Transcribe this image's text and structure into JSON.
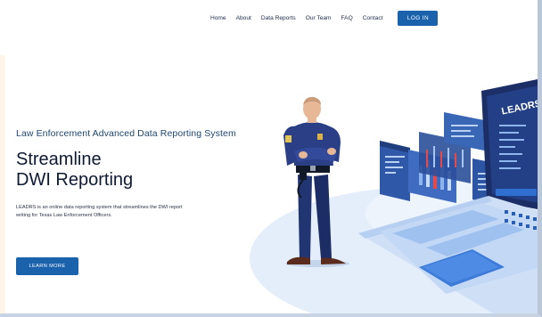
{
  "nav": {
    "items": [
      {
        "id": "home",
        "label": "Home"
      },
      {
        "id": "about",
        "label": "About"
      },
      {
        "id": "data-reports",
        "label": "Data Reports"
      },
      {
        "id": "our-team",
        "label": "Our Team"
      },
      {
        "id": "faq",
        "label": "FAQ"
      },
      {
        "id": "contact",
        "label": "Contact"
      }
    ],
    "login_label": "LOG IN"
  },
  "hero": {
    "kicker": "Law Enforcement Advanced Data Reporting System",
    "title_line1": "Streamline",
    "title_line2": "DWI Reporting",
    "description": "LEADRS is an online data reporting system that streamlines the DWI report writing for Texas Law Enforcement Officers.",
    "cta_label": "LEARN MORE"
  },
  "illustration": {
    "screen_brand": "LEADRS"
  },
  "colors": {
    "accent": "#1b62ad",
    "heading": "#0e1a33",
    "kicker": "#1d4670"
  }
}
